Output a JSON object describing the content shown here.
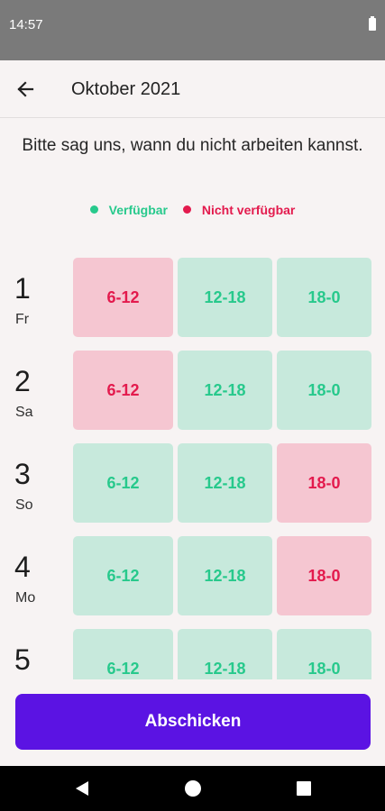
{
  "status_bar": {
    "time": "14:57"
  },
  "header": {
    "title": "Oktober 2021",
    "back_icon": "arrow-left-icon"
  },
  "prompt": "Bitte sag uns, wann du nicht arbeiten kannst.",
  "legend": {
    "available": {
      "label": "Verfügbar",
      "color": "#27c98c"
    },
    "unavailable": {
      "label": "Nicht verfügbar",
      "color": "#e31a4d"
    }
  },
  "days": [
    {
      "number": "1",
      "weekday": "Fr",
      "slots": [
        {
          "label": "6-12",
          "status": "unavailable"
        },
        {
          "label": "12-18",
          "status": "available"
        },
        {
          "label": "18-0",
          "status": "available"
        }
      ]
    },
    {
      "number": "2",
      "weekday": "Sa",
      "slots": [
        {
          "label": "6-12",
          "status": "unavailable"
        },
        {
          "label": "12-18",
          "status": "available"
        },
        {
          "label": "18-0",
          "status": "available"
        }
      ]
    },
    {
      "number": "3",
      "weekday": "So",
      "slots": [
        {
          "label": "6-12",
          "status": "available"
        },
        {
          "label": "12-18",
          "status": "available"
        },
        {
          "label": "18-0",
          "status": "unavailable"
        }
      ]
    },
    {
      "number": "4",
      "weekday": "Mo",
      "slots": [
        {
          "label": "6-12",
          "status": "available"
        },
        {
          "label": "12-18",
          "status": "available"
        },
        {
          "label": "18-0",
          "status": "unavailable"
        }
      ]
    },
    {
      "number": "5",
      "weekday": "",
      "slots": [
        {
          "label": "6-12",
          "status": "available"
        },
        {
          "label": "12-18",
          "status": "available"
        },
        {
          "label": "18-0",
          "status": "available"
        }
      ]
    }
  ],
  "submit_label": "Abschicken",
  "colors": {
    "accent": "#5b13e3",
    "available_bg": "#c7e9dc",
    "unavailable_bg": "#f5c6d1"
  }
}
